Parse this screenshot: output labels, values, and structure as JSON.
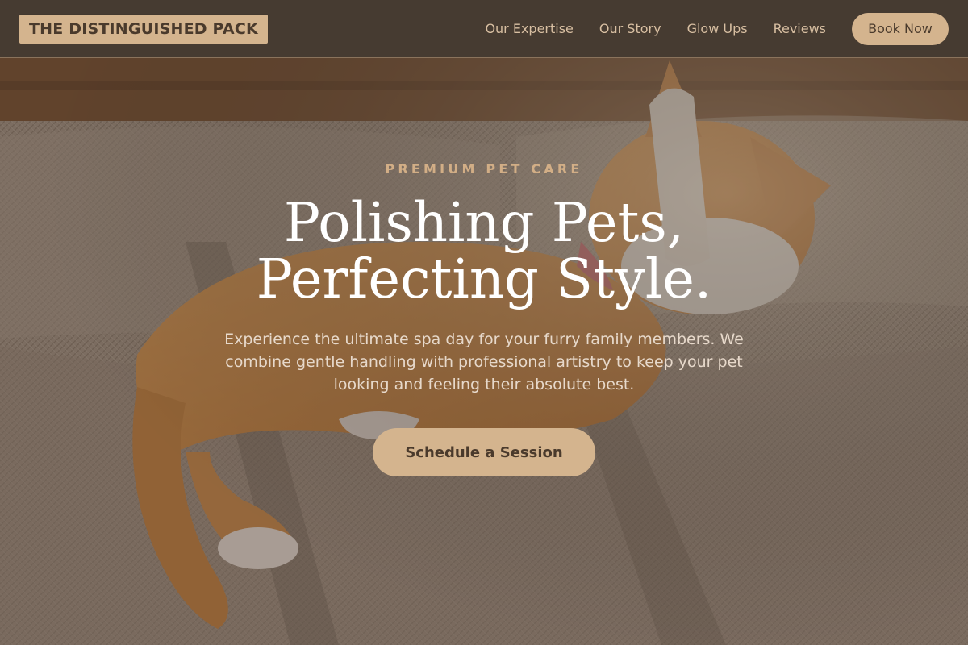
{
  "brand": {
    "logo_text": "THE DISTINGUISHED PACK",
    "colors": {
      "nav_bg": "#463b31",
      "accent": "#d4b48e",
      "accent_text": "#4a3a2c",
      "nav_link": "#d8bfa2",
      "eyebrow": "#d2ae86"
    }
  },
  "nav": {
    "links": [
      {
        "label": "Our Expertise"
      },
      {
        "label": "Our Story"
      },
      {
        "label": "Glow Ups"
      },
      {
        "label": "Reviews"
      }
    ],
    "book_label": "Book Now"
  },
  "hero": {
    "eyebrow": "PREMIUM PET CARE",
    "headline_line1": "Polishing Pets,",
    "headline_line2": "Perfecting Style.",
    "subtext": "Experience the ultimate spa day for your furry family members. We combine gentle handling with professional artistry to keep your pet looking and feeling their absolute best.",
    "cta_label": "Schedule a Session",
    "background_image": "orange cat stretching on a woven couch"
  }
}
